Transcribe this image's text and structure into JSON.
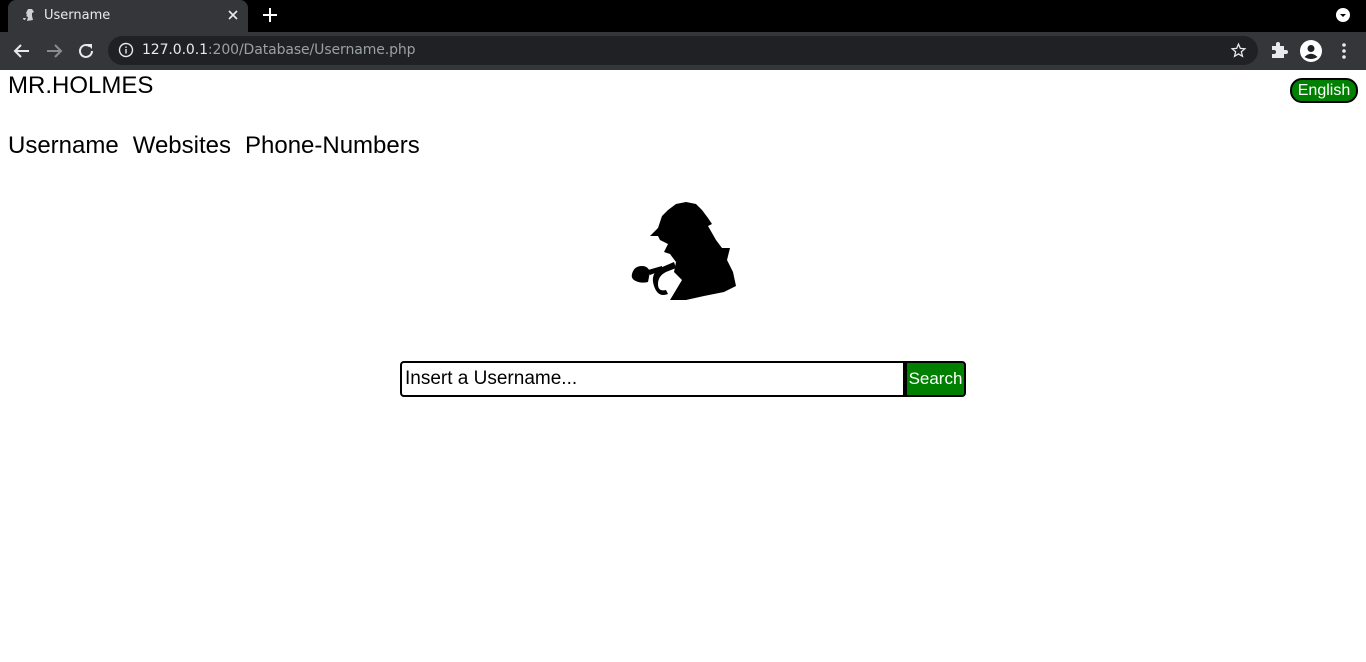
{
  "browser": {
    "tab_title": "Username",
    "url_host": "127.0.0.1",
    "url_rest": ":200/Database/Username.php",
    "icons": [
      "sherlock-favicon-icon",
      "close-icon",
      "plus-icon",
      "chevron-down-icon",
      "back-arrow-icon",
      "forward-arrow-icon",
      "reload-icon",
      "info-icon",
      "star-icon",
      "puzzle-icon",
      "profile-icon",
      "kebab-menu-icon"
    ]
  },
  "header": {
    "brand": "MR.HOLMES",
    "language_button": "English"
  },
  "nav": {
    "items": [
      {
        "label": "Username"
      },
      {
        "label": "Websites"
      },
      {
        "label": "Phone-Numbers"
      }
    ]
  },
  "logo": {
    "icon": "sherlock-silhouette-icon"
  },
  "search": {
    "placeholder": "Insert a Username...",
    "button_label": "Search"
  },
  "colors": {
    "accent": "#008000",
    "chrome_dark": "#35363a",
    "tabbar": "#000000",
    "omnibox": "#202124"
  }
}
